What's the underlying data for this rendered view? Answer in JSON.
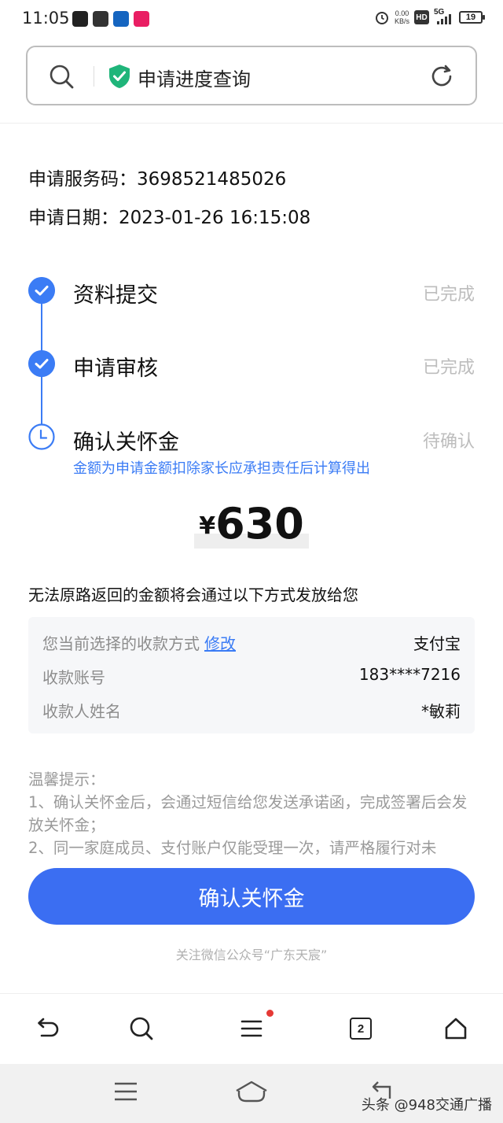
{
  "status_bar": {
    "time": "11:05",
    "net_speed_value": "0.00",
    "net_speed_unit": "KB/s",
    "hd_label": "HD",
    "network_type": "5G",
    "battery": "19"
  },
  "address_bar": {
    "title": "申请进度查询"
  },
  "application": {
    "service_code_line": "申请服务码：3698521485026",
    "date_line": "申请日期：2023-01-26 16:15:08"
  },
  "steps": [
    {
      "label": "资料提交",
      "status": "已完成"
    },
    {
      "label": "申请审核",
      "status": "已完成"
    },
    {
      "label": "确认关怀金",
      "status": "待确认"
    }
  ],
  "step_note": "金额为申请金额扣除家长应承担责任后计算得出",
  "amount": {
    "symbol": "¥",
    "value": "630"
  },
  "payout_note": "无法原路返回的金额将会通过以下方式发放给您",
  "payment": {
    "method_label": "您当前选择的收款方式",
    "modify_link": "修改",
    "method_value": "支付宝",
    "account_label": "收款账号",
    "account_value": "183****7216",
    "name_label": "收款人姓名",
    "name_value": "*敏莉"
  },
  "tips": {
    "title": "温馨提示：",
    "item1": "1、确认关怀金后，会通过短信给您发送承诺函，完成签署后会发放关怀金；",
    "item2": "2、同一家庭成员、支付账户仅能受理一次，请严格履行对未"
  },
  "confirm_button": "确认关怀金",
  "footer_note": "关注微信公众号“广东天宸”",
  "browser_toolbar": {
    "tab_count": "2"
  },
  "watermark": "头条 @948交通广播",
  "colors": {
    "accent": "#3b7cf5",
    "button": "#3b6ef2",
    "shield": "#1fb57a",
    "muted": "#bdbdbd",
    "notification_dot": "#e53935"
  }
}
